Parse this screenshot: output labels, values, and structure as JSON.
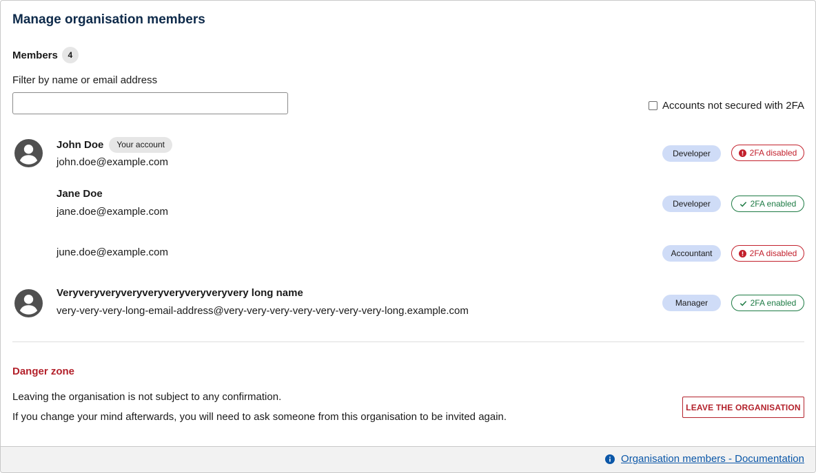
{
  "page": {
    "title": "Manage organisation members"
  },
  "members_section": {
    "label": "Members",
    "count": "4",
    "filter_label": "Filter by name or email address",
    "filter_value": "",
    "filter_placeholder": "",
    "twofa_filter_label": "Accounts not secured with 2FA"
  },
  "members": [
    {
      "name": "John Doe",
      "badge": "Your account",
      "email": "john.doe@example.com",
      "role": "Developer",
      "twofa": "2FA disabled",
      "twofa_state": "disabled",
      "avatar": "person-avatar-icon"
    },
    {
      "name": "Jane Doe",
      "badge": "",
      "email": "jane.doe@example.com",
      "role": "Developer",
      "twofa": "2FA enabled",
      "twofa_state": "enabled",
      "avatar": ""
    },
    {
      "name": "",
      "badge": "",
      "email": "june.doe@example.com",
      "role": "Accountant",
      "twofa": "2FA disabled",
      "twofa_state": "disabled",
      "avatar": ""
    },
    {
      "name": "Veryveryveryveryveryveryveryveryvery long name",
      "badge": "",
      "email": "very-very-very-long-email-address@very-very-very-very-very-very-very-long.example.com",
      "role": "Manager",
      "twofa": "2FA enabled",
      "twofa_state": "enabled",
      "avatar": "person-avatar-icon"
    }
  ],
  "danger_zone": {
    "title": "Danger zone",
    "line1": "Leaving the organisation is not subject to any confirmation.",
    "line2": "If you change your mind afterwards, you will need to ask someone from this organisation to be invited again.",
    "leave_button": "LEAVE THE ORGANISATION"
  },
  "footer": {
    "doc_link": "Organisation members - Documentation",
    "icon": "info-icon"
  },
  "colors": {
    "title": "#0e2a4a",
    "danger": "#b3212b",
    "enabled": "#1c7a43",
    "role_badge": "#cfdcf7",
    "link": "#0b57a8"
  }
}
